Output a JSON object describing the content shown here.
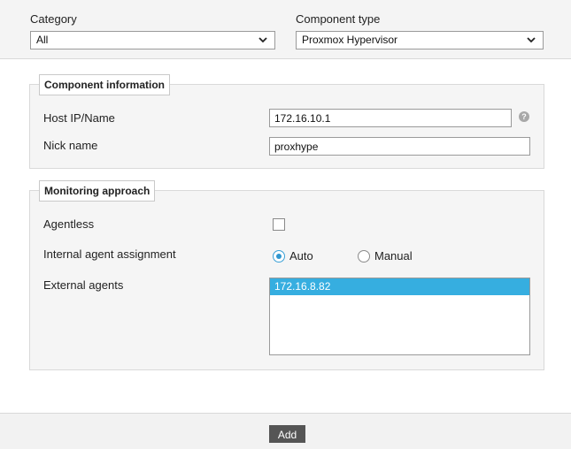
{
  "header": {
    "category_label": "Category",
    "category_value": "All",
    "component_type_label": "Component type",
    "component_type_value": "Proxmox Hypervisor"
  },
  "component_info": {
    "legend": "Component information",
    "host_label": "Host IP/Name",
    "host_value": "172.16.10.1",
    "help_icon": "?",
    "nick_label": "Nick name",
    "nick_value": "proxhype"
  },
  "monitoring": {
    "legend": "Monitoring approach",
    "agentless_label": "Agentless",
    "agentless_checked": false,
    "assignment_label": "Internal agent assignment",
    "auto_label": "Auto",
    "manual_label": "Manual",
    "selected_assignment": "Auto",
    "external_label": "External agents",
    "external_agents": [
      "172.16.8.82"
    ]
  },
  "footer": {
    "add_label": "Add"
  },
  "colors": {
    "accent": "#36aee0",
    "button": "#555555"
  }
}
